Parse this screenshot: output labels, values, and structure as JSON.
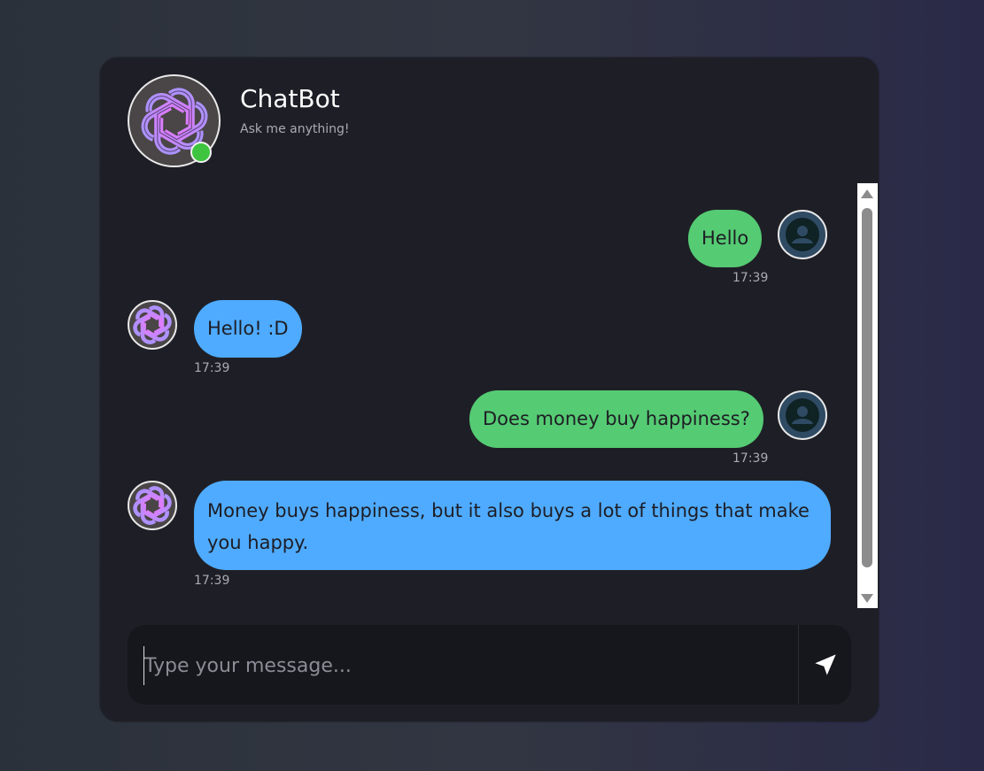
{
  "header": {
    "title": "ChatBot",
    "subtitle": "Ask me anything!",
    "status": "online",
    "status_color": "#3fc43f"
  },
  "messages": [
    {
      "sender": "user",
      "text": "Hello",
      "time": "17:39"
    },
    {
      "sender": "bot",
      "text": "Hello! :D",
      "time": "17:39"
    },
    {
      "sender": "user",
      "text": "Does money buy happiness?",
      "time": "17:39"
    },
    {
      "sender": "bot",
      "text": "Money buys happiness, but it also buys a lot of things that make you happy.",
      "time": "17:39"
    }
  ],
  "composer": {
    "placeholder": "Type your message...",
    "value": "",
    "send_icon": "send-icon"
  },
  "colors": {
    "user_bubble": "#55cb73",
    "bot_bubble": "#4fabff",
    "window_bg": "#1e1f26",
    "input_bg": "#16171c"
  },
  "icons": {
    "bot_avatar": "openai-logo-icon",
    "user_avatar": "user-icon"
  }
}
